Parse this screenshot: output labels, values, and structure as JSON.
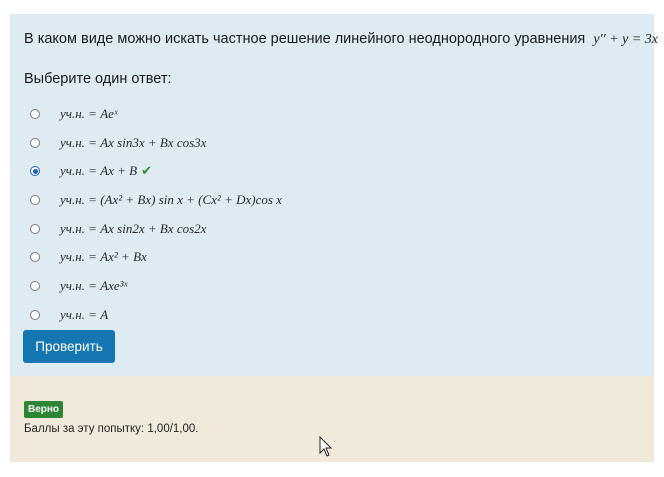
{
  "question": {
    "text": "В каком виде можно искать частное решение линейного неоднородного уравнения",
    "equation": "y′′ + y = 3x"
  },
  "prompt": "Выберите один ответ:",
  "options": [
    {
      "formula": "yч.н. = Aeˣ",
      "selected": false
    },
    {
      "formula": "yч.н. = Ax sin3x + Bx cos3x",
      "selected": false
    },
    {
      "formula": "yч.н. = Ax + B",
      "selected": true,
      "correct_mark": "✔"
    },
    {
      "formula": "yч.н. = (Ax² + Bx) sin x + (Cx² + Dx)cos x",
      "selected": false
    },
    {
      "formula": "yч.н. = Ax sin2x + Bx cos2x",
      "selected": false
    },
    {
      "formula": "yч.н. = Ax² + Bx",
      "selected": false
    },
    {
      "formula": "yч.н. = Axe³ˣ",
      "selected": false
    },
    {
      "formula": "yч.н. = A",
      "selected": false
    }
  ],
  "check_button": "Проверить",
  "feedback": {
    "status": "Верно",
    "score": "Баллы за эту попытку: 1,00/1,00."
  },
  "colors": {
    "card_bg": "#deebf3",
    "feedback_bg": "#f1eadb",
    "button": "#1477b2",
    "correct_badge": "#2d8633"
  }
}
